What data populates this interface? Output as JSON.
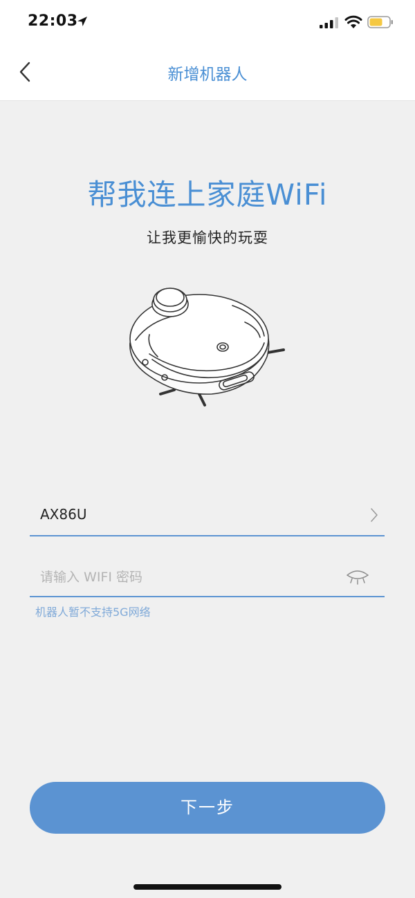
{
  "status_bar": {
    "time": "22:03",
    "battery_color": "#f5c842"
  },
  "header": {
    "title": "新增机器人",
    "back_icon": "chevron-left-icon"
  },
  "main": {
    "headline": "帮我连上家庭WiFi",
    "subtitle": "让我更愉快的玩耍",
    "ssid_field": {
      "value": "AX86U",
      "icon": "chevron-right-icon"
    },
    "password_field": {
      "placeholder": "请输入 WIFI 密码",
      "icon": "eye-closed-icon"
    },
    "hint": "机器人暂不支持5G网络",
    "next_button": "下一步"
  },
  "colors": {
    "accent": "#5b93d2",
    "title": "#4a8fd4",
    "background": "#f0f0f0"
  }
}
